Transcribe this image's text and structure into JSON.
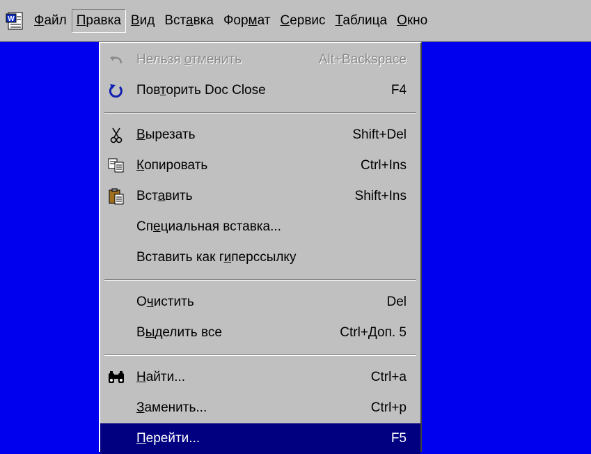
{
  "colors": {
    "desktop": "#0000ee",
    "menu_bg": "#c0c0c0",
    "highlight_bg": "#000080",
    "highlight_fg": "#ffffff",
    "disabled_fg": "#8a8a8a"
  },
  "menubar": {
    "app_icon": "word-document-icon",
    "items": [
      {
        "label": "Файл",
        "u": 0
      },
      {
        "label": "Правка",
        "u": 0,
        "active": true
      },
      {
        "label": "Вид",
        "u": 0
      },
      {
        "label": "Вставка",
        "u": 3
      },
      {
        "label": "Формат",
        "u": 3
      },
      {
        "label": "Сервис",
        "u": 0
      },
      {
        "label": "Таблица",
        "u": 0
      },
      {
        "label": "Окно",
        "u": 0
      }
    ]
  },
  "dropdown": {
    "items": [
      {
        "type": "item",
        "name": "undo",
        "label": "Нельзя отменить",
        "u": 7,
        "shortcut": "Alt+Backspace",
        "icon": "undo-icon",
        "disabled": true
      },
      {
        "type": "item",
        "name": "redo",
        "label": "Повторить Doc Close",
        "u": 3,
        "shortcut": "F4",
        "icon": "redo-icon"
      },
      {
        "type": "separator"
      },
      {
        "type": "item",
        "name": "cut",
        "label": "Вырезать",
        "u": 0,
        "shortcut": "Shift+Del",
        "icon": "scissors-icon"
      },
      {
        "type": "item",
        "name": "copy",
        "label": "Копировать",
        "u": 0,
        "shortcut": "Ctrl+Ins",
        "icon": "copy-icon"
      },
      {
        "type": "item",
        "name": "paste",
        "label": "Вставить",
        "u": 3,
        "shortcut": "Shift+Ins",
        "icon": "paste-icon"
      },
      {
        "type": "item",
        "name": "paste-special",
        "label": "Специальная вставка...",
        "u": 2,
        "shortcut": ""
      },
      {
        "type": "item",
        "name": "paste-hyperlink",
        "label": "Вставить как гиперссылку",
        "u": 14,
        "shortcut": ""
      },
      {
        "type": "separator"
      },
      {
        "type": "item",
        "name": "clear",
        "label": "Очистить",
        "u": 1,
        "shortcut": "Del"
      },
      {
        "type": "item",
        "name": "select-all",
        "label": "Выделить все",
        "u": 1,
        "shortcut": "Ctrl+Доп. 5"
      },
      {
        "type": "separator"
      },
      {
        "type": "item",
        "name": "find",
        "label": "Найти...",
        "u": 0,
        "shortcut": "Ctrl+a",
        "icon": "binoculars-icon"
      },
      {
        "type": "item",
        "name": "replace",
        "label": "Заменить...",
        "u": 0,
        "shortcut": "Ctrl+p"
      },
      {
        "type": "item",
        "name": "goto",
        "label": "Перейти...",
        "u": 0,
        "shortcut": "F5",
        "highlighted": true
      }
    ]
  }
}
